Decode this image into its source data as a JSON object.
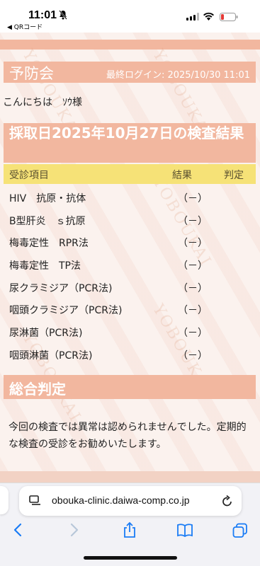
{
  "status_bar": {
    "time": "11:01",
    "back_label": "◀ QRコード"
  },
  "header": {
    "title": "予防会",
    "last_login": "最終ログイン: 2025/10/30 11:01"
  },
  "greeting": "こんにちは　ｿｳ様",
  "watermark_text": "YOBOUKAI",
  "results": {
    "heading": "採取日2025年10月27日の検査結果",
    "columns": {
      "item": "受診項目",
      "result": "結果",
      "judgement": "判定"
    },
    "rows": [
      {
        "item": "HIV　抗原・抗体",
        "result": "（－）",
        "judgement": ""
      },
      {
        "item": "B型肝炎　ｓ抗原",
        "result": "（－）",
        "judgement": ""
      },
      {
        "item": "梅毒定性　RPR法",
        "result": "（－）",
        "judgement": ""
      },
      {
        "item": "梅毒定性　TP法",
        "result": "（－）",
        "judgement": ""
      },
      {
        "item": "尿クラミジア（PCR法)",
        "result": "（－）",
        "judgement": ""
      },
      {
        "item": "咽頭クラミジア（PCR法)",
        "result": "（－）",
        "judgement": ""
      },
      {
        "item": "尿淋菌（PCR法)",
        "result": "（－）",
        "judgement": ""
      },
      {
        "item": "咽頭淋菌（PCR法)",
        "result": "（－）",
        "judgement": ""
      }
    ]
  },
  "summary": {
    "heading": "総合判定",
    "text": "今回の検査では異常は認められませんでした。定期的な検査の受診をお勧めいたします。"
  },
  "browser": {
    "url": "yobouka-clinic.daiwa-comp.co.jp",
    "url_display": "obouka-clinic.daiwa-comp.co.jp"
  },
  "colors": {
    "accent": "#f2b79f",
    "table_header": "#f6e277",
    "ios_blue": "#1a7cf5"
  }
}
